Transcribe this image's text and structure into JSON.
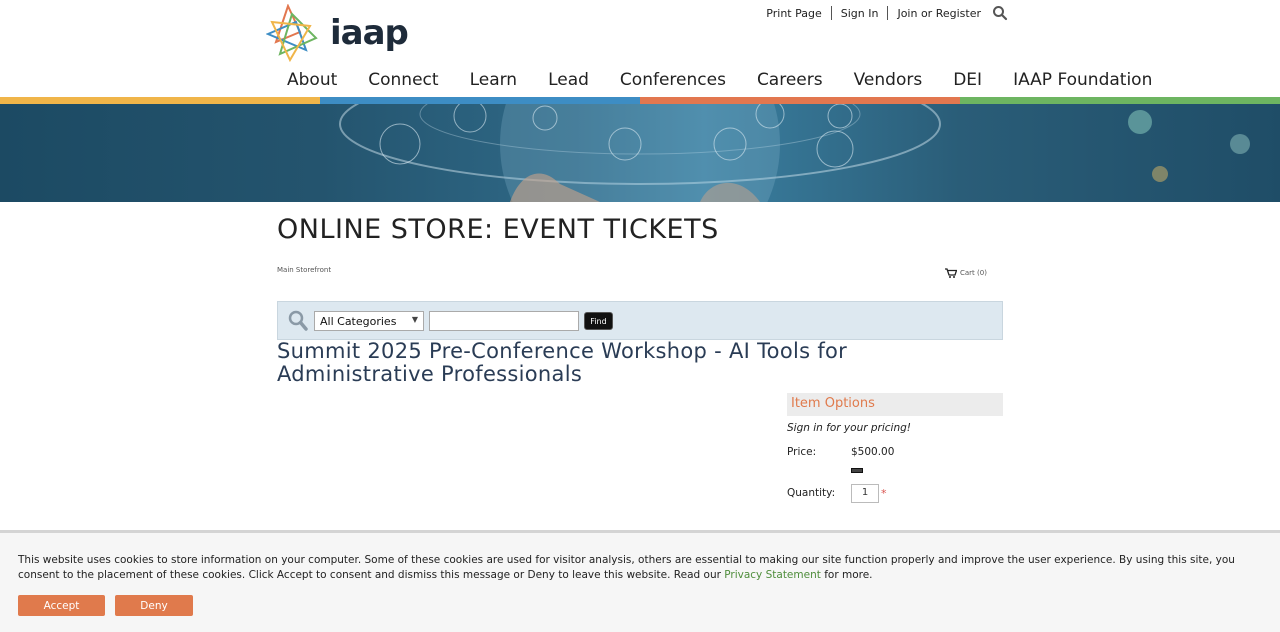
{
  "header": {
    "logo_text": "iaap",
    "util_links": {
      "print": "Print Page",
      "sign_in": "Sign In",
      "join": "Join or Register"
    },
    "nav": [
      "About",
      "Connect",
      "Learn",
      "Lead",
      "Conferences",
      "Careers",
      "Vendors",
      "DEI",
      "IAAP Foundation"
    ],
    "color_bar": [
      "#f0b549",
      "#3d8dc4",
      "#e2774f",
      "#6db561"
    ]
  },
  "main": {
    "page_title": "ONLINE STORE: EVENT TICKETS",
    "breadcrumb": "Main Storefront",
    "cart_label": "Cart (0)",
    "search": {
      "category_selected": "All Categories",
      "keyword_value": "",
      "find_label": "Find"
    },
    "product_title": "Summit 2025 Pre-Conference Workshop - AI Tools for Administrative Professionals",
    "item_options": {
      "heading": "Item Options",
      "signin_message": "Sign in for your pricing!",
      "price_label": "Price:",
      "price_value": "$500.00",
      "quantity_label": "Quantity:",
      "quantity_value": "1",
      "required_mark": "*"
    }
  },
  "cookie": {
    "text_before_link": "This website uses cookies to store information on your computer. Some of these cookies are used for visitor analysis, others are essential to making our site function properly and improve the user experience. By using this site, you consent to the placement of these cookies. Click Accept to consent and dismiss this message or Deny to leave this website. Read our ",
    "link_text": "Privacy Statement",
    "text_after_link": " for more.",
    "accept_label": "Accept",
    "deny_label": "Deny"
  },
  "colors": {
    "accent_orange": "#e07a4c",
    "link_green": "#4e8d3b",
    "title_navy": "#2a3c55"
  }
}
